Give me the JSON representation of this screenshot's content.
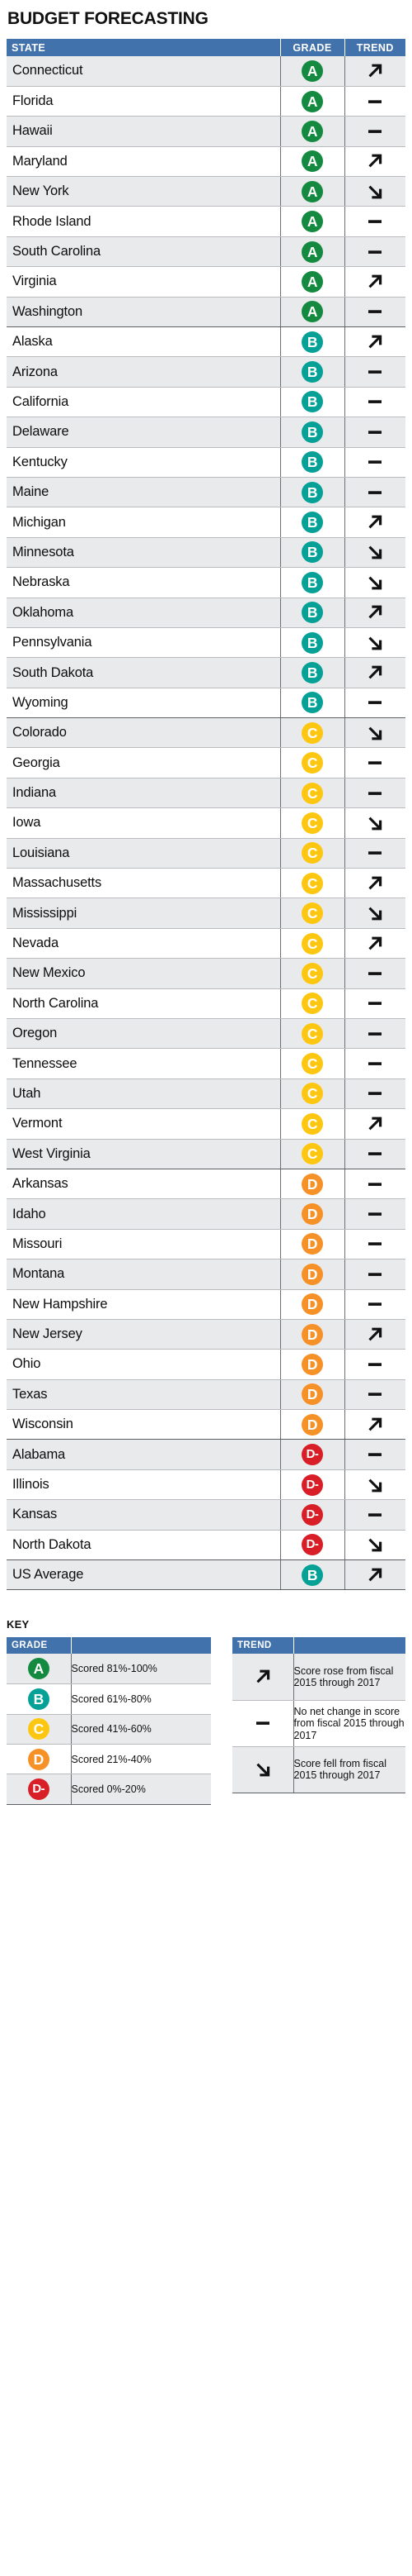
{
  "title": "BUDGET FORECASTING",
  "colors": {
    "header_blue": "#4272ab",
    "grade_A": "#138a3f",
    "grade_B": "#05a096",
    "grade_C": "#fdc711",
    "grade_D": "#f69128",
    "grade_Dminus": "#d81f27",
    "row_shade": "#e9eaec",
    "rule": "#b9bbbe"
  },
  "table": {
    "columns": [
      "STATE",
      "GRADE",
      "TREND"
    ],
    "rows": [
      {
        "state": "Connecticut",
        "grade": "A",
        "trend": "up"
      },
      {
        "state": "Florida",
        "grade": "A",
        "trend": "flat"
      },
      {
        "state": "Hawaii",
        "grade": "A",
        "trend": "flat"
      },
      {
        "state": "Maryland",
        "grade": "A",
        "trend": "up"
      },
      {
        "state": "New York",
        "grade": "A",
        "trend": "down"
      },
      {
        "state": "Rhode Island",
        "grade": "A",
        "trend": "flat"
      },
      {
        "state": "South Carolina",
        "grade": "A",
        "trend": "flat"
      },
      {
        "state": "Virginia",
        "grade": "A",
        "trend": "up"
      },
      {
        "state": "Washington",
        "grade": "A",
        "trend": "flat",
        "group_end": true
      },
      {
        "state": "Alaska",
        "grade": "B",
        "trend": "up"
      },
      {
        "state": "Arizona",
        "grade": "B",
        "trend": "flat"
      },
      {
        "state": "California",
        "grade": "B",
        "trend": "flat"
      },
      {
        "state": "Delaware",
        "grade": "B",
        "trend": "flat"
      },
      {
        "state": "Kentucky",
        "grade": "B",
        "trend": "flat"
      },
      {
        "state": "Maine",
        "grade": "B",
        "trend": "flat"
      },
      {
        "state": "Michigan",
        "grade": "B",
        "trend": "up"
      },
      {
        "state": "Minnesota",
        "grade": "B",
        "trend": "down"
      },
      {
        "state": "Nebraska",
        "grade": "B",
        "trend": "down"
      },
      {
        "state": "Oklahoma",
        "grade": "B",
        "trend": "up"
      },
      {
        "state": "Pennsylvania",
        "grade": "B",
        "trend": "down"
      },
      {
        "state": "South Dakota",
        "grade": "B",
        "trend": "up"
      },
      {
        "state": "Wyoming",
        "grade": "B",
        "trend": "flat",
        "group_end": true
      },
      {
        "state": "Colorado",
        "grade": "C",
        "trend": "down"
      },
      {
        "state": "Georgia",
        "grade": "C",
        "trend": "flat"
      },
      {
        "state": "Indiana",
        "grade": "C",
        "trend": "flat"
      },
      {
        "state": "Iowa",
        "grade": "C",
        "trend": "down"
      },
      {
        "state": "Louisiana",
        "grade": "C",
        "trend": "flat"
      },
      {
        "state": "Massachusetts",
        "grade": "C",
        "trend": "up"
      },
      {
        "state": "Mississippi",
        "grade": "C",
        "trend": "down"
      },
      {
        "state": "Nevada",
        "grade": "C",
        "trend": "up"
      },
      {
        "state": "New Mexico",
        "grade": "C",
        "trend": "flat"
      },
      {
        "state": "North Carolina",
        "grade": "C",
        "trend": "flat"
      },
      {
        "state": "Oregon",
        "grade": "C",
        "trend": "flat"
      },
      {
        "state": "Tennessee",
        "grade": "C",
        "trend": "flat"
      },
      {
        "state": "Utah",
        "grade": "C",
        "trend": "flat"
      },
      {
        "state": "Vermont",
        "grade": "C",
        "trend": "up"
      },
      {
        "state": "West Virginia",
        "grade": "C",
        "trend": "flat",
        "group_end": true
      },
      {
        "state": "Arkansas",
        "grade": "D",
        "trend": "flat"
      },
      {
        "state": "Idaho",
        "grade": "D",
        "trend": "flat"
      },
      {
        "state": "Missouri",
        "grade": "D",
        "trend": "flat"
      },
      {
        "state": "Montana",
        "grade": "D",
        "trend": "flat"
      },
      {
        "state": "New Hampshire",
        "grade": "D",
        "trend": "flat"
      },
      {
        "state": "New Jersey",
        "grade": "D",
        "trend": "up"
      },
      {
        "state": "Ohio",
        "grade": "D",
        "trend": "flat"
      },
      {
        "state": "Texas",
        "grade": "D",
        "trend": "flat"
      },
      {
        "state": "Wisconsin",
        "grade": "D",
        "trend": "up",
        "group_end": true
      },
      {
        "state": "Alabama",
        "grade": "D-",
        "trend": "flat"
      },
      {
        "state": "Illinois",
        "grade": "D-",
        "trend": "down"
      },
      {
        "state": "Kansas",
        "grade": "D-",
        "trend": "flat"
      },
      {
        "state": "North Dakota",
        "grade": "D-",
        "trend": "down",
        "group_end": true
      },
      {
        "state": "US Average",
        "grade": "B",
        "trend": "up"
      }
    ]
  },
  "key": {
    "label": "KEY",
    "grade_header": "GRADE",
    "trend_header": "TREND",
    "grade_rows": [
      {
        "grade": "A",
        "desc": "Scored 81%-100%"
      },
      {
        "grade": "B",
        "desc": "Scored 61%-80%"
      },
      {
        "grade": "C",
        "desc": "Scored 41%-60%"
      },
      {
        "grade": "D",
        "desc": "Scored 21%-40%"
      },
      {
        "grade": "D-",
        "desc": "Scored 0%-20%"
      }
    ],
    "trend_rows": [
      {
        "trend": "up",
        "desc": "Score rose from fiscal 2015 through 2017"
      },
      {
        "trend": "flat",
        "desc": "No net change in score from fiscal 2015 through 2017"
      },
      {
        "trend": "down",
        "desc": "Score fell from fiscal 2015 through 2017"
      }
    ]
  }
}
